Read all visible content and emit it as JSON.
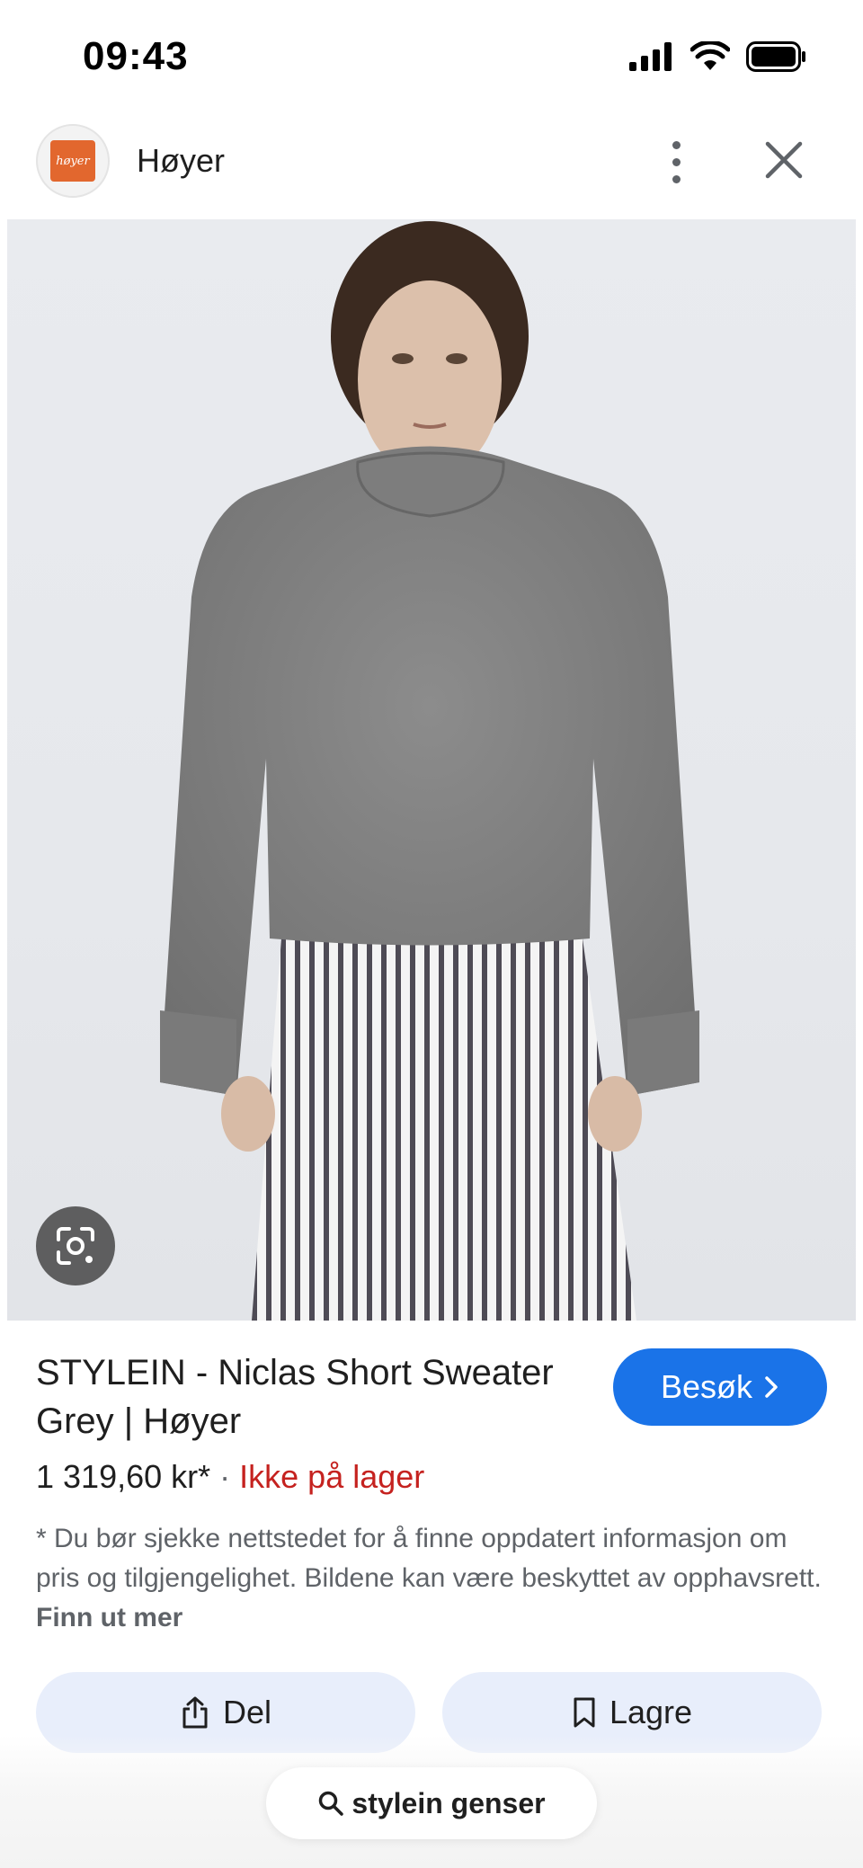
{
  "status_bar": {
    "time": "09:43"
  },
  "header": {
    "site_name": "Høyer",
    "logo_text": "høyer"
  },
  "product": {
    "title": "STYLEIN - Niclas Short Sweater Grey | Høyer",
    "price": "1 319,60 kr*",
    "separator": "·",
    "availability": "Ikke på lager",
    "visit_label": "Besøk"
  },
  "disclaimer": {
    "text": "* Du bør sjekke nettstedet for å finne oppdatert informasjon om pris og tilgjengelighet. Bildene kan være beskyttet av opphavsrett. ",
    "link": "Finn ut mer"
  },
  "actions": {
    "share_label": "Del",
    "save_label": "Lagre"
  },
  "search": {
    "query": "stylein genser"
  },
  "colors": {
    "accent": "#1a73e8",
    "stock_out": "#c5221f",
    "logo": "#e2672e",
    "chip_bg": "#e8eefb"
  }
}
